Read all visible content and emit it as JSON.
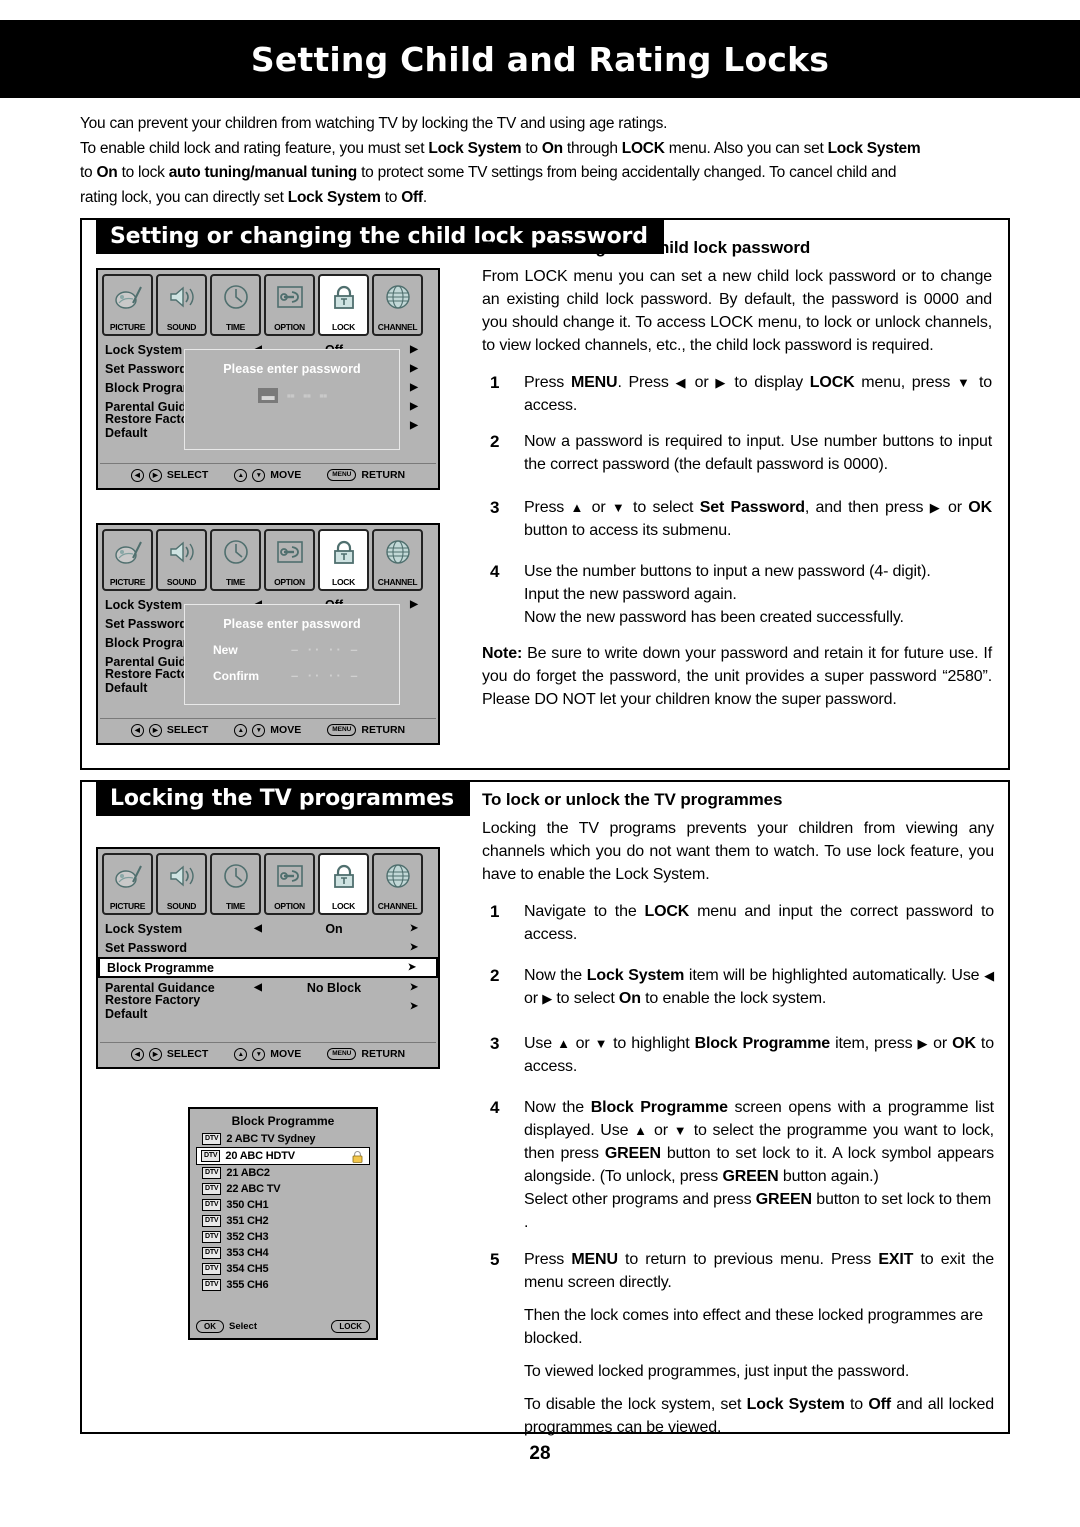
{
  "page": {
    "title": "Setting Child and Rating Locks",
    "number": "28"
  },
  "intro": {
    "line1": "You can prevent your children from watching TV by locking the TV and using age ratings.",
    "line2_a": "To enable child lock and rating feature, you must set ",
    "line2_b": "Lock System",
    "line2_c": " to ",
    "line2_d": "On",
    "line2_e": " through ",
    "line2_f": "LOCK",
    "line2_g": " menu. Also you can set ",
    "line2_h": "Lock System",
    "line3_a": "to ",
    "line3_b": "On",
    "line3_c": " to lock ",
    "line3_d": "auto tuning/manual tuning",
    "line3_e": " to protect some TV settings from being accidentally changed.  To cancel child  and",
    "line4_a": "rating lock, you can directly set ",
    "line4_b": "Lock System",
    "line4_c": " to ",
    "line4_d": "Off",
    "line4_e": "."
  },
  "sections": {
    "password": {
      "header": "Setting or changing the child lock password",
      "heading": "To set or change the child lock password",
      "body": "From LOCK menu you can set a new child lock password or to change an existing child lock password. By default, the password is 0000 and you should change it. To access LOCK menu, to lock or unlock channels, to view locked channels, etc., the child lock password is required.",
      "steps": [
        {
          "num": "1",
          "parts": [
            "Press ",
            "MENU",
            ". Press ",
            "◀",
            " or ",
            "▶",
            "  to display ",
            "LOCK",
            " menu, press ",
            "▼",
            " to access."
          ]
        },
        {
          "num": "2",
          "text": "Now a password is required to input. Use number buttons to input the correct password (the default password is 0000)."
        },
        {
          "num": "3",
          "parts": [
            "Press ",
            "▲",
            " or ",
            "▼",
            " to select ",
            "Set Password",
            ", and then press ",
            "▶",
            " or ",
            "OK",
            " button to access its submenu."
          ]
        },
        {
          "num": "4",
          "text": "Use  the number buttons to input a  new password (4- digit).",
          "sub1": "Input the new password again.",
          "sub2": "Now the new password has been created successfully."
        }
      ],
      "note_label": "Note:",
      "note_text": "  Be sure to write down your password and retain it for future use. If you do forget the password, the unit provides a  super password “2580”. Please DO NOT let your children know the super password."
    },
    "locking": {
      "header": "Locking the TV programmes",
      "heading": "To lock or unlock the TV programmes",
      "body": "Locking the TV programs prevents your children from viewing any channels which you do not want them to watch. To use lock feature, you have to enable the Lock System.",
      "steps": [
        {
          "num": "1",
          "parts": [
            "Navigate to the ",
            "LOCK",
            " menu and input the correct password to access."
          ]
        },
        {
          "num": "2",
          "parts": [
            "Now the ",
            "Lock System",
            " item will be highlighted automatically. Use ",
            "◀",
            " or ",
            "▶",
            " to select ",
            "On",
            " to enable the lock system."
          ]
        },
        {
          "num": "3",
          "parts": [
            "Use ",
            "▲",
            " or ",
            "▼",
            " to highlight ",
            "Block Programme",
            " item, press ",
            "▶",
            " or ",
            "OK",
            " to access."
          ]
        },
        {
          "num": "4",
          "parts": [
            "Now the ",
            "Block Programme",
            " screen opens with a programme list displayed. Use ",
            "▲",
            " or ",
            "▼",
            " to select the programme you want to lock, then press ",
            "GREEN",
            " button to set lock to it. A lock symbol appears alongside.  (To unlock, press ",
            "GREEN",
            " button again.)"
          ],
          "sub1_parts": [
            "Select other programs and press ",
            "GREEN",
            " button to set lock to them ."
          ]
        },
        {
          "num": "5",
          "parts": [
            "Press ",
            "MENU",
            " to return to previous menu. Press ",
            "EXIT",
            " to exit the menu screen directly."
          ],
          "sub1": "Then the lock comes into effect and these locked programmes are blocked.",
          "sub2": "To viewed locked programmes, just input the password.",
          "sub3_parts": [
            "To disable the lock system, set ",
            "Lock System",
            " to ",
            "Off",
            " and all locked programmes can be viewed."
          ]
        }
      ]
    }
  },
  "osd": {
    "menu_icons": [
      {
        "label": "PICTURE",
        "icon": "picture-icon",
        "selected": false
      },
      {
        "label": "SOUND",
        "icon": "sound-icon",
        "selected": false
      },
      {
        "label": "TIME",
        "icon": "clock-icon",
        "selected": false
      },
      {
        "label": "OPTION",
        "icon": "option-icon",
        "selected": false
      },
      {
        "label": "LOCK",
        "icon": "lock-icon",
        "selected": true
      },
      {
        "label": "CHANNEL",
        "icon": "globe-icon",
        "selected": false
      }
    ],
    "rows_off": [
      {
        "name": "Lock System",
        "value": "Off",
        "left_arrow": "◀",
        "right_arrow": "▶",
        "highlighted": false
      },
      {
        "name": "Set Password",
        "value": "",
        "left_arrow": "",
        "right_arrow": "▶",
        "highlighted": false
      },
      {
        "name": "Block Programme",
        "value": "",
        "left_arrow": "",
        "right_arrow": "▶",
        "highlighted": false
      },
      {
        "name": "Parental Guidance",
        "value": "",
        "left_arrow": "",
        "right_arrow": "▶",
        "highlighted": false
      },
      {
        "name": "Restore Factory Default",
        "value": "",
        "left_arrow": "",
        "right_arrow": "▶",
        "highlighted": false
      }
    ],
    "rows_on": [
      {
        "name": "Lock System",
        "value": "On",
        "left_arrow": "◀",
        "right_arrow": "➤",
        "highlighted": false
      },
      {
        "name": "Set Password",
        "value": "",
        "left_arrow": "",
        "right_arrow": "➤",
        "highlighted": false
      },
      {
        "name": "Block Programme",
        "value": "",
        "left_arrow": "",
        "right_arrow": "➤",
        "highlighted": true
      },
      {
        "name": "Parental Guidance",
        "value": "No Block",
        "left_arrow": "◀",
        "right_arrow": "➤",
        "highlighted": false
      },
      {
        "name": "Restore Factory Default",
        "value": "",
        "left_arrow": "",
        "right_arrow": "➤",
        "highlighted": false
      }
    ],
    "footer": {
      "select_label": "SELECT",
      "move_label": "MOVE",
      "return_label": "RETURN",
      "menu_pill": "MENU",
      "left_icon": "◀",
      "right_icon": "▶",
      "up_icon": "▲",
      "down_icon": "▼"
    },
    "popup1": {
      "title": "Please enter password",
      "digits": [
        "▬",
        "▪▪",
        "▪▪",
        "▪▪"
      ]
    },
    "popup2": {
      "title": "Please enter password",
      "new_label": "New",
      "confirm_label": "Confirm",
      "dashes": "–  ··  ··  –"
    }
  },
  "block_dialog": {
    "title": "Block Programme",
    "badge": "DTV",
    "channels": [
      {
        "name": "2 ABC TV Sydney",
        "locked": false,
        "highlighted": false
      },
      {
        "name": "20 ABC HDTV",
        "locked": true,
        "highlighted": true
      },
      {
        "name": "21 ABC2",
        "locked": false,
        "highlighted": false
      },
      {
        "name": "22 ABC TV",
        "locked": false,
        "highlighted": false
      },
      {
        "name": "350 CH1",
        "locked": false,
        "highlighted": false
      },
      {
        "name": "351 CH2",
        "locked": false,
        "highlighted": false
      },
      {
        "name": "352 CH3",
        "locked": false,
        "highlighted": false
      },
      {
        "name": "353 CH4",
        "locked": false,
        "highlighted": false
      },
      {
        "name": "354 CH5",
        "locked": false,
        "highlighted": false
      },
      {
        "name": "355 CH6",
        "locked": false,
        "highlighted": false
      }
    ],
    "footer": {
      "ok": "OK",
      "select": "Select",
      "lock": "LOCK"
    }
  },
  "colors": {
    "osd_gray": "#b4b4b4",
    "highlight_white": "#ffffff",
    "banner_black": "#000000",
    "lock_icon_gold": "#f2c64b",
    "icon_teal": "#bfe0df"
  }
}
